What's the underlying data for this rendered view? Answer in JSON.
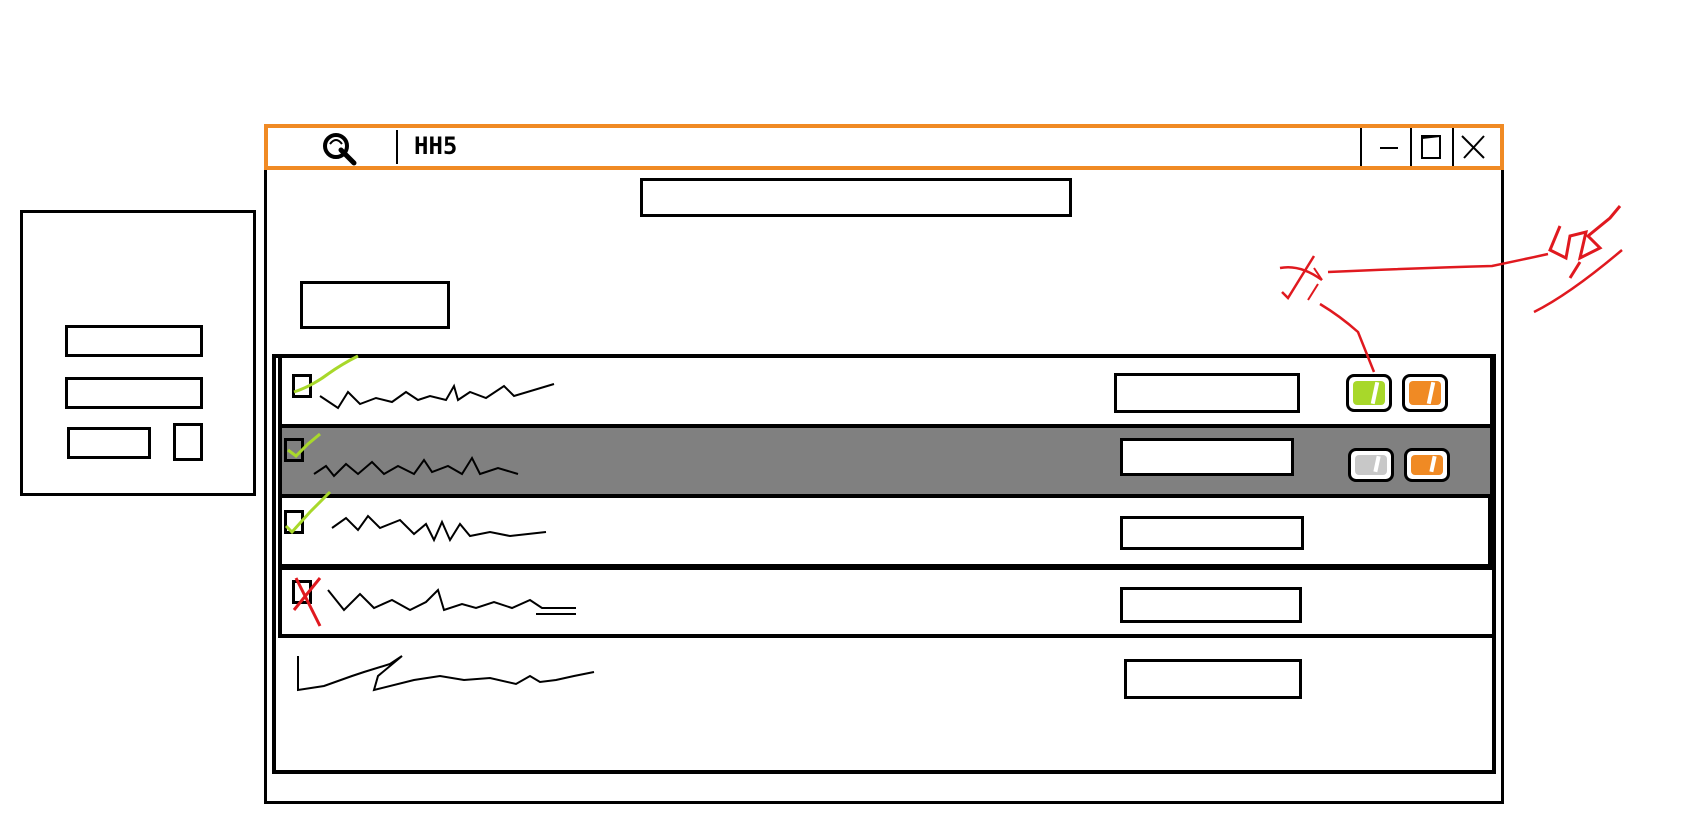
{
  "colors": {
    "titlebar_border": "#f08a24",
    "approve_green": "#a8d82a",
    "edit_orange": "#f08a24",
    "annotation_red": "#e0191f",
    "selected_row": "#808080",
    "disabled_gray": "#c8c8c8"
  },
  "window": {
    "app_icon": "magnifier-app-icon",
    "title": "HH5",
    "controls": [
      "minimize-icon",
      "maximize-icon",
      "close-icon"
    ]
  },
  "list": {
    "rows": [
      {
        "checkbox_state": "checked-green",
        "selected": false,
        "has_actions": true,
        "approve_enabled": true
      },
      {
        "checkbox_state": "checked-green",
        "selected": true,
        "has_actions": true,
        "approve_enabled": false
      },
      {
        "checkbox_state": "checked-green",
        "selected": false,
        "has_actions": false
      },
      {
        "checkbox_state": "crossed-red",
        "selected": false,
        "has_actions": false
      },
      {
        "checkbox_state": "none",
        "selected": false,
        "has_actions": false
      }
    ]
  },
  "annotation": {
    "target": "approve-button-row-1",
    "mark": "red-cross-with-arrow"
  }
}
